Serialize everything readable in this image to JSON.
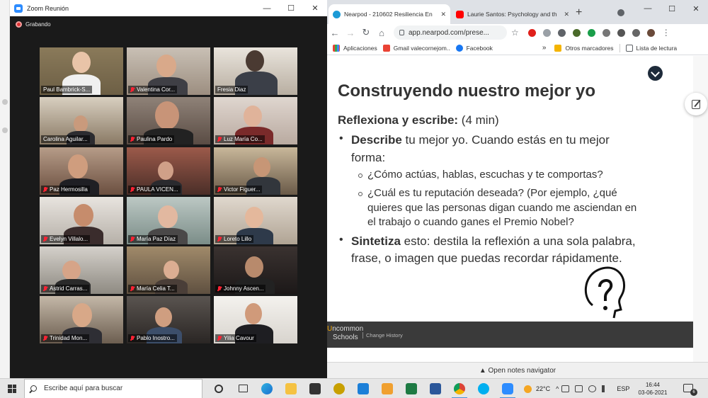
{
  "zoom": {
    "window_title": "Zoom Reunión",
    "recording_label": "Grabando",
    "participants": [
      {
        "name": "Paul Bambrick-S...",
        "muted": false,
        "active": true
      },
      {
        "name": "Valentina Cor...",
        "muted": true
      },
      {
        "name": "Fresia Diaz",
        "muted": false
      },
      {
        "name": "Carolina Aguilar...",
        "muted": false
      },
      {
        "name": "Paulina Pardo",
        "muted": true
      },
      {
        "name": "Luz María Co...",
        "muted": true
      },
      {
        "name": "Paz Hermosilla",
        "muted": true
      },
      {
        "name": "PAULA VICEN...",
        "muted": true
      },
      {
        "name": "Victor Figuer...",
        "muted": true
      },
      {
        "name": "Evelyn Villalo...",
        "muted": true
      },
      {
        "name": "María Paz Díaz",
        "muted": true
      },
      {
        "name": "Loreto Lillo",
        "muted": true
      },
      {
        "name": "Astrid Carras...",
        "muted": true
      },
      {
        "name": "María Celia T...",
        "muted": true
      },
      {
        "name": "Johnny Ascen...",
        "muted": true
      },
      {
        "name": "Trinidad Mon...",
        "muted": true
      },
      {
        "name": "Pablo Inostro...",
        "muted": true
      },
      {
        "name": "Yilia Cavour",
        "muted": true
      }
    ]
  },
  "chrome": {
    "tabs": [
      {
        "title": "Nearpod - 210602 Resiliencia En",
        "active": true,
        "icon": "nearpod-icon"
      },
      {
        "title": "Laurie Santos: Psychology and th",
        "active": false,
        "icon": "youtube-icon"
      }
    ],
    "url": "app.nearpod.com/prese...",
    "bookmarks": [
      "Aplicaciones",
      "Gmail valecornejom..",
      "Facebook"
    ],
    "bookmarks_more": "»",
    "other_bookmarks": "Otros marcadores",
    "reading_list": "Lista de lectura"
  },
  "slide": {
    "title": "Construyendo nuestro mejor yo",
    "subtitle_bold": "Reflexiona y escribe:",
    "subtitle_rest": " (4 min)",
    "b1_bold": "Describe",
    "b1_line1": " tu mejor yo. Cuando estás en tu mejor",
    "b1_line2": "forma:",
    "s1": "¿Cómo actúas, hablas, escuchas y te comportas?",
    "s2_l1": "¿Cuál es tu reputación deseada? (Por ejemplo, ¿qué",
    "s2_l2": "quieres que las personas digan cuando me asciendan en",
    "s2_l3": "el trabajo o cuando ganes el Premio Nobel?",
    "b2_bold": "Sintetiza",
    "b2_line1": " esto: destila la reflexión a una sola palabra,",
    "b2_line2": "frase, o imagen que puedas recordar rápidamente.",
    "footer_logo_a": "ncommon",
    "footer_logo_b": "Schools",
    "footer_logo_mark": "U",
    "footer_tag": "Change History",
    "notes_navigator": "▲ Open notes navigator"
  },
  "taskbar": {
    "search_placeholder": "Escribe aquí para buscar",
    "temperature": "22°C",
    "language": "ESP",
    "time": "16:44",
    "date": "03-06-2021",
    "notifications": "6"
  }
}
